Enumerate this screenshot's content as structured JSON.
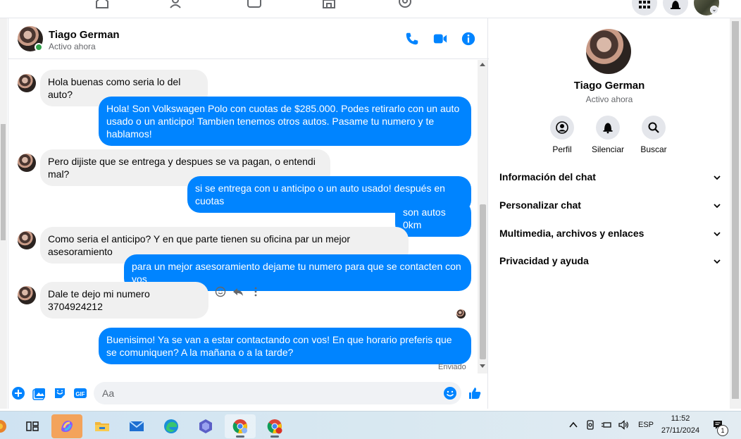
{
  "contact": {
    "name": "Tiago German",
    "status": "Activo ahora"
  },
  "messages": [
    {
      "direction": "in",
      "text": "Hola buenas como seria lo del auto?"
    },
    {
      "direction": "out",
      "text": "Hola! Son Volkswagen Polo con cuotas de $285.000. Podes retirarlo con un auto usado o un anticipo! Tambien tenemos otros autos. Pasame tu numero y te hablamos!"
    },
    {
      "direction": "in",
      "text": "Pero dijiste que se entrega y despues se va pagan, o entendi mal?"
    },
    {
      "direction": "out",
      "text": "si se entrega con u anticipo o un auto usado! después en cuotas"
    },
    {
      "direction": "out",
      "text": "son autos 0km"
    },
    {
      "direction": "in",
      "text": "Como seria el anticipo? Y en que parte tienen su oficina par un mejor asesoramiento"
    },
    {
      "direction": "out",
      "text": "para un mejor asesoramiento dejame tu numero para que se contacten con vos"
    },
    {
      "direction": "in",
      "text": "Dale te dejo mi numero 3704924212"
    },
    {
      "direction": "out",
      "text": "Buenisimo! Ya se van a estar contactando con vos! En que horario preferis que se comuniquen? A la mañana o a la tarde?"
    }
  ],
  "sent_label": "Enviado",
  "composer": {
    "placeholder": "Aa"
  },
  "info_panel": {
    "actions": [
      {
        "label": "Perfil",
        "icon": "profile-icon"
      },
      {
        "label": "Silenciar",
        "icon": "bell-icon"
      },
      {
        "label": "Buscar",
        "icon": "search-icon"
      }
    ],
    "sections": [
      "Información del chat",
      "Personalizar chat",
      "Multimedia, archivos y enlaces",
      "Privacidad y ayuda"
    ]
  },
  "taskbar": {
    "apps": [
      "copilot",
      "task-view",
      "file-explorer",
      "mail",
      "edge",
      "teams",
      "chrome",
      "chrome-profile"
    ],
    "tray": {
      "language": "ESP",
      "time": "11:52",
      "date": "27/11/2024",
      "notification_count": "1"
    }
  },
  "colors": {
    "accent": "#0084ff",
    "incoming_bubble": "#f0f0f0",
    "online": "#31a24c"
  }
}
